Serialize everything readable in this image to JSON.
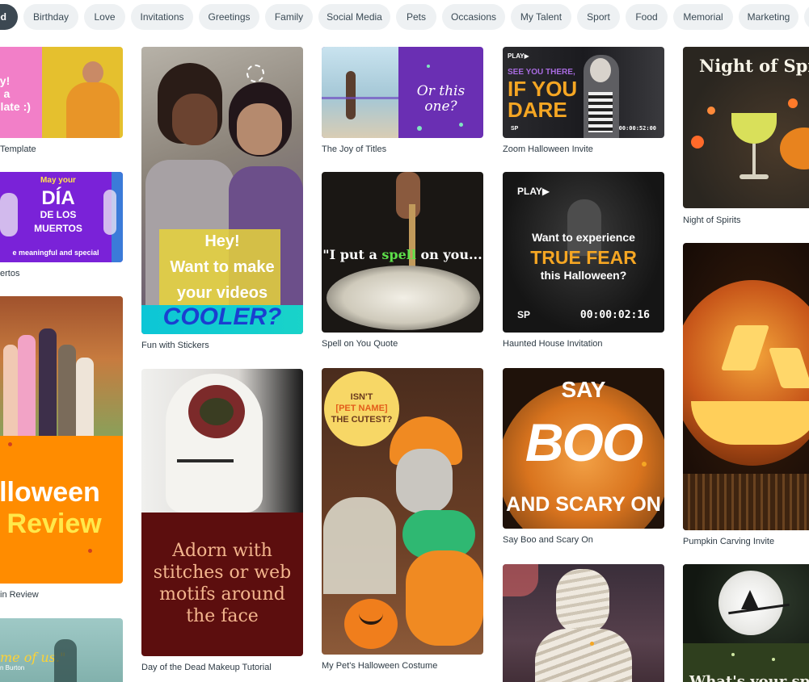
{
  "chips": [
    "ed",
    "Birthday",
    "Love",
    "Invitations",
    "Greetings",
    "Family",
    "Social Media",
    "Pets",
    "Occasions",
    "My Talent",
    "Sport",
    "Food",
    "Memorial",
    "Marketing"
  ],
  "colors": {
    "chip_bg": "#eef1f3",
    "chip_active_bg": "#3c4852",
    "caption": "#2d3a44"
  },
  "cards": {
    "template": {
      "caption": "Template",
      "text": [
        "ey!",
        "n a",
        "plate :)"
      ]
    },
    "muertos": {
      "caption": "ertos",
      "text": [
        "May your",
        "DÍA",
        "DE LOS",
        "MUERTOS",
        "e meaningful and special"
      ]
    },
    "review": {
      "caption": "in Review",
      "text": [
        "alloween",
        "n Review"
      ]
    },
    "partial_bottom": {
      "text": [
        "me of us.\"",
        "n Burton"
      ]
    },
    "stickers": {
      "caption": "Fun with Stickers",
      "text": [
        "Hey!",
        "Want to make",
        "your videos",
        "COOLER?"
      ]
    },
    "makeup": {
      "caption": "Day of the Dead Makeup Tutorial",
      "text": [
        "Adorn with",
        "stitches or web",
        "motifs around",
        "the face"
      ]
    },
    "titles": {
      "caption": "The Joy of Titles",
      "text": [
        "Or this one?"
      ]
    },
    "spell": {
      "caption": "Spell on You Quote",
      "text": [
        "\"I put a ",
        "spell",
        " on you..."
      ]
    },
    "pet": {
      "caption": "My Pet's Halloween Costume",
      "text": [
        "ISN'T",
        "[PET NAME]",
        "THE CUTEST?"
      ]
    },
    "zoom": {
      "caption": "Zoom Halloween Invite",
      "text": [
        "PLAY▶",
        "SEE YOU THERE,",
        "IF YOU",
        "DARE",
        "SP",
        "00:00:52:00"
      ]
    },
    "haunted": {
      "caption": "Haunted House Invitation",
      "text": [
        "PLAY▶",
        "Want to experience",
        "TRUE FEAR",
        "this Halloween?",
        "SP",
        "00:00:02:16"
      ]
    },
    "boo": {
      "caption": "Say Boo and Scary On",
      "text": [
        "SAY",
        "BOO",
        "AND SCARY ON"
      ]
    },
    "spirits": {
      "caption": "Night of Spirits",
      "text": [
        "Night of Spiri"
      ]
    },
    "pumpkin": {
      "caption": "Pumpkin Carving Invite"
    },
    "witch": {
      "text": [
        "What's your spo"
      ]
    }
  }
}
